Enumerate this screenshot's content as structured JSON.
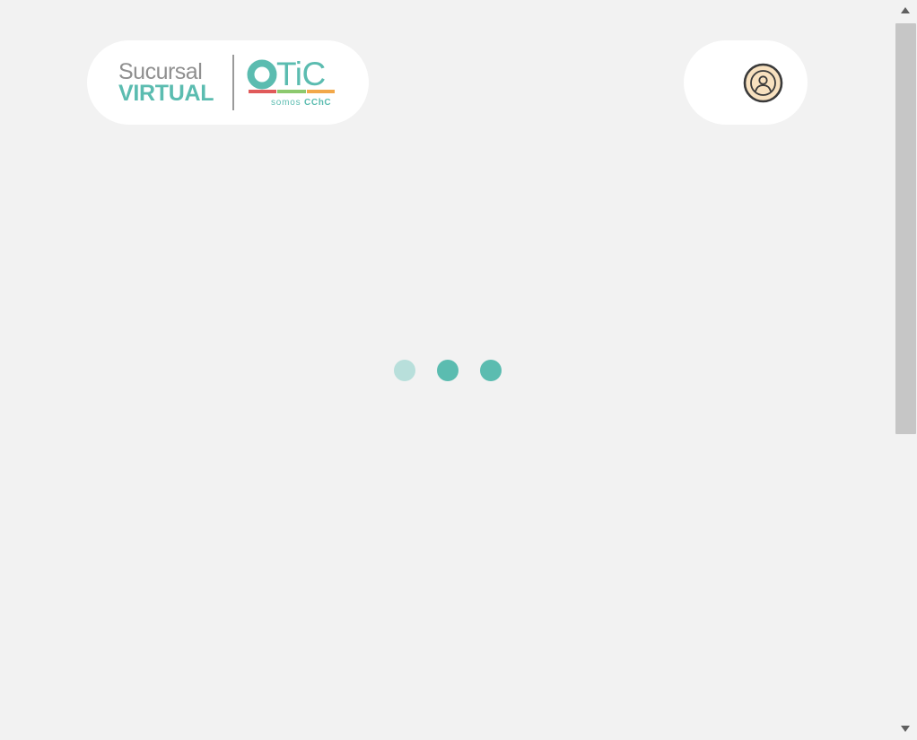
{
  "header": {
    "brand": {
      "line1": "Sucursal",
      "line2": "VIRTUAL",
      "otic_text": "TiC",
      "otic_o": "O",
      "somos": "somos",
      "cchc": "CChC"
    },
    "user_menu": {
      "icon": "user-circle-icon"
    }
  },
  "loader": {
    "dots": 3,
    "icon": "loading-dots"
  },
  "colors": {
    "background": "#f2f2f2",
    "brand_gray": "#8f8f8f",
    "brand_teal": "#5bbcb0",
    "loader_dot": "#5bbcb0",
    "loader_dot_faded": "#b8dfdb",
    "user_icon_fill": "#f8e1bf",
    "user_icon_stroke": "#3a3a3a",
    "bar_red": "#e05a5a",
    "bar_green": "#8cc96e",
    "bar_orange": "#f2a84a"
  }
}
